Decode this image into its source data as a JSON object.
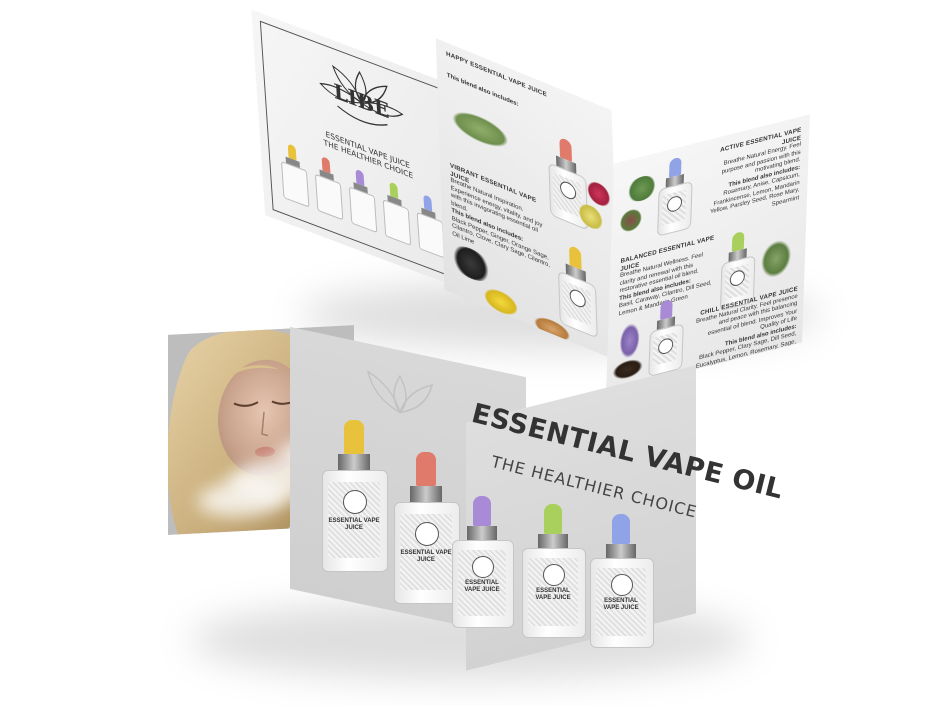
{
  "brand": {
    "logo_text": "LIBE",
    "tagline_line1": "ESSENTIAL VAPE JUICE",
    "tagline_line2": "THE HEALTHIER CHOICE"
  },
  "colors": {
    "yellow": "#e8c23a",
    "red": "#e07a6a",
    "purple": "#a88ad6",
    "green": "#a9cf5c",
    "blue": "#8fa3e6",
    "paper": "#eeeeee",
    "ink": "#333333"
  },
  "sections": {
    "happy": {
      "title": "HAPPY ESSENTIAL VAPE JUICE",
      "sub": "This blend also includes:"
    },
    "vibrant": {
      "title": "VIBRANT ESSENTIAL VAPE JUICE",
      "body": "Breathe Natural Inspiration. Experience energy, vitality, and joy with this invigorating essential oil blend.",
      "sub": "This blend also includes:",
      "ingredients": "Black Pepper, Ginger, Orange Sage, Cilantro, Clove, Clary Sage, Cilantro, Oil Lime"
    },
    "active": {
      "title": "ACTIVE ESSENTIAL VAPE JUICE",
      "body": "Breathe Natural Energy. Feel purpose and passion with this motivating blend.",
      "sub": "This blend also includes:",
      "ingredients": "Rosemary, Anise, Capsicum, Frankincense, Lemon, Mandarin Yellow, Parsley Seed, Rose Mary, Spearmint"
    },
    "balanced": {
      "title": "BALANCED ESSENTIAL VAPE JUICE",
      "body": "Breathe Natural Wellness. Feel clarity and renewal with this restorative essential oil blend.",
      "sub": "This blend also includes:",
      "ingredients": "Basil, Caraway, Cilantro, Dill Seed, Lemon & Mandarin Green"
    },
    "chill": {
      "title": "CHILL ESSENTIAL VAPE JUICE",
      "body": "Breathe Natural Clarity. Feel presence and peace with this balancing essential oil blend. Improves Your Quality of Life",
      "sub": "This blend also includes:",
      "ingredients": "Black Pepper, Clary Sage, Dill Seed, Eucalyptus, Lemon, Rosemary, Sage, Spearmint & Tea Tree"
    }
  },
  "cover": {
    "headline": "ESSENTIAL VAPE OIL",
    "subhead": "THE HEALTHIER CHOICE",
    "bottle_label": "ESSENTIAL VAPE JUICE"
  }
}
